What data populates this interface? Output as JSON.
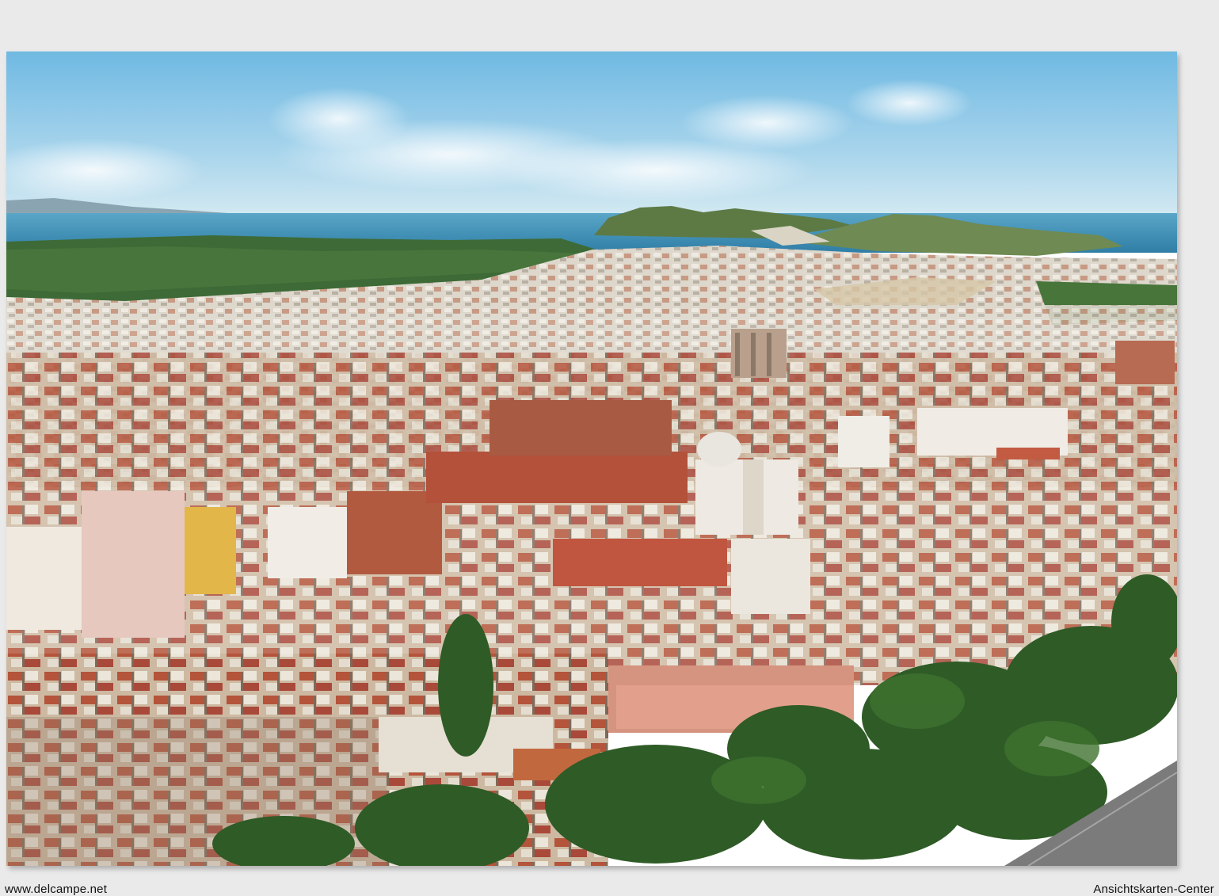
{
  "scene": {
    "subject": "aerial-city-panorama",
    "colors": {
      "sky_top": "#7fc3e6",
      "sky_bottom": "#cfe6f0",
      "sea": "#3f8fb5",
      "hills": "#3f6b3a",
      "roofs_terracotta": "#b5523a",
      "buildings_white": "#e8e2d8",
      "trees": "#2f5a24",
      "road": "#7b7b7b"
    }
  },
  "footer": {
    "left_text": "www.delcampe.net",
    "right_text": "Ansichtskarten-Center"
  }
}
